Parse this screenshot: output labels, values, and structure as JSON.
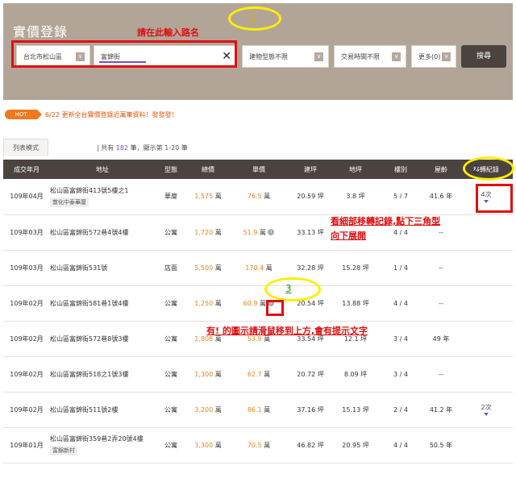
{
  "search": {
    "title": "實價登錄",
    "region": "台北市松山區",
    "road": "富錦街",
    "building_type": "建物型態不限",
    "trade_time": "交易時間不限",
    "more": "更多(0)",
    "search_button": "搜尋",
    "clear": "✕",
    "dropdown": "∨"
  },
  "annotations": {
    "a1_num": "1",
    "a1_text": "請在此輸入路名",
    "a2_num": "2",
    "a2_text_line1": "看細部移轉記錄,點下三角型",
    "a2_text_line2": "向下展開",
    "a3_num": "3",
    "a3_text": "有! 的圖示請滑鼠移到上方,會有提示文字"
  },
  "hot": {
    "badge": "HOT",
    "text": "6/22 更新全台實價登錄近萬筆資料！發發發！"
  },
  "list": {
    "tab": "列表模式",
    "count_prefix": "| 共有",
    "count": "182",
    "count_suffix": "筆，顯示第 1-20 筆"
  },
  "table": {
    "headers": [
      "成交年月",
      "地址",
      "型態",
      "總價",
      "單價",
      "建坪",
      "地坪",
      "樓別",
      "屋齡",
      "移轉紀錄"
    ],
    "rows": [
      {
        "date": "109年04月",
        "addr": "松山區富錦街413號5樓之1",
        "sub": "敦化中泰華廈",
        "type": "華廈",
        "total": "1,575",
        "unit": "76.5",
        "info": "",
        "build": "20.59",
        "land": "3.8",
        "floor": "5 / 7",
        "age": "41.6 年",
        "moves": "4次"
      },
      {
        "date": "109年03月",
        "addr": "松山區富錦街572巷4號4樓",
        "sub": "",
        "type": "公寓",
        "total": "1,720",
        "unit": "51.9",
        "info": "i",
        "build": "33.13",
        "land": "",
        "floor": "4 / 4",
        "age": "--",
        "moves": ""
      },
      {
        "date": "109年03月",
        "addr": "松山區富錦街531號",
        "sub": "",
        "type": "店面",
        "total": "5,500",
        "unit": "170.4",
        "info": "",
        "build": "32.28",
        "land": "15.28",
        "floor": "1 / 4",
        "age": "--",
        "moves": ""
      },
      {
        "date": "109年02月",
        "addr": "松山區富錦街581巷1號4樓",
        "sub": "",
        "type": "公寓",
        "total": "1,250",
        "unit": "60.9",
        "info": "i",
        "build": "20.54",
        "land": "13.88",
        "floor": "4 / 4",
        "age": "--",
        "moves": ""
      },
      {
        "date": "109年02月",
        "addr": "松山區富錦街572巷8號3樓",
        "sub": "",
        "type": "公寓",
        "total": "1,808",
        "unit": "53.9",
        "info": "",
        "build": "33.54",
        "land": "12.1",
        "floor": "3 / 4",
        "age": "49 年",
        "moves": ""
      },
      {
        "date": "109年02月",
        "addr": "松山區富錦街518之1號3樓",
        "sub": "",
        "type": "公寓",
        "total": "1,300",
        "unit": "62.7",
        "info": "",
        "build": "20.72",
        "land": "8.09",
        "floor": "3 / 4",
        "age": "--",
        "moves": ""
      },
      {
        "date": "109年02月",
        "addr": "松山區富錦街511號2樓",
        "sub": "",
        "type": "公寓",
        "total": "3,200",
        "unit": "86.1",
        "info": "",
        "build": "37.16",
        "land": "15.13",
        "floor": "2 / 4",
        "age": "41.2 年",
        "moves": "2次"
      },
      {
        "date": "109年01月",
        "addr": "松山區富錦街359巷2弄20號4樓",
        "sub": "富錦新村",
        "type": "公寓",
        "total": "3,300",
        "unit": "70.5",
        "info": "",
        "build": "46.82",
        "land": "20.95",
        "floor": "4 / 4",
        "age": "50.5 年",
        "moves": ""
      }
    ],
    "wan": "萬",
    "ping": "坪"
  },
  "colors": {
    "panel": "#b2a598",
    "header": "#4a4340",
    "accent_orange": "#e8821e",
    "accent_purple": "#7a4fb0",
    "annotation_red": "#e01010",
    "annotation_yellow": "#ffee00"
  },
  "icons": {
    "clear": "close-icon",
    "dropdown": "chevron-down-icon",
    "info": "info-icon",
    "expand": "triangle-down-icon"
  }
}
